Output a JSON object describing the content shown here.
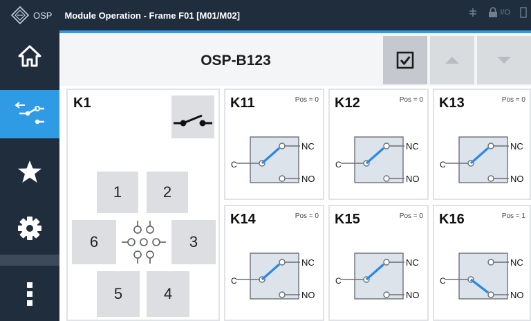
{
  "titlebar": {
    "app_name": "OSP",
    "title": "Module Operation - Frame F01 [M01/M02]",
    "status_text": "I/O"
  },
  "sidebar": {
    "items": [
      {
        "name": "home",
        "icon": "home-icon"
      },
      {
        "name": "switch",
        "icon": "switch-icon",
        "active": true
      },
      {
        "name": "favorites",
        "icon": "star-icon"
      },
      {
        "name": "settings",
        "icon": "gear-icon"
      },
      {
        "name": "more",
        "icon": "more-vertical-icon"
      }
    ]
  },
  "header": {
    "module_name": "OSP-B123",
    "buttons": [
      "checkbox-icon",
      "arrow-up-icon",
      "arrow-down-icon"
    ]
  },
  "k1": {
    "label": "K1",
    "positions": [
      "1",
      "2",
      "3",
      "4",
      "5",
      "6"
    ]
  },
  "relays": [
    {
      "name": "K11",
      "pos": "Pos = 0",
      "state": 0
    },
    {
      "name": "K12",
      "pos": "Pos = 0",
      "state": 0
    },
    {
      "name": "K13",
      "pos": "Pos = 0",
      "state": 0
    },
    {
      "name": "K14",
      "pos": "Pos = 0",
      "state": 0
    },
    {
      "name": "K15",
      "pos": "Pos = 0",
      "state": 0
    },
    {
      "name": "K16",
      "pos": "Pos = 1",
      "state": 1
    }
  ],
  "relay_labels": {
    "common": "C",
    "nc": "NC",
    "no": "NO"
  },
  "colors": {
    "primary": "#1f2d3d",
    "accent": "#2f9be5",
    "button": "#dcdee2"
  }
}
